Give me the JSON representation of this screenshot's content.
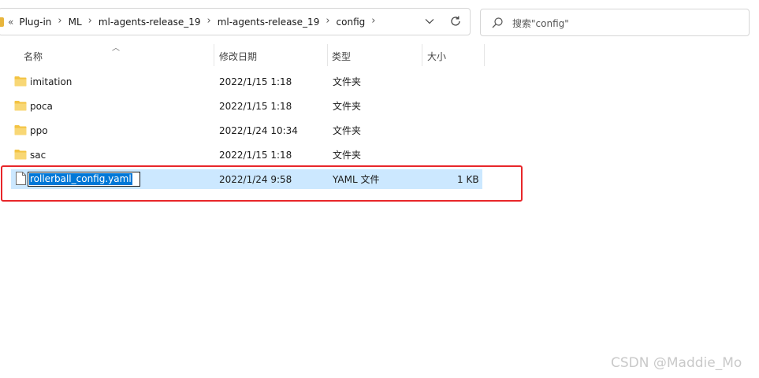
{
  "address_bar": {
    "overflow": "«",
    "crumbs": [
      "Plug-in",
      "ML",
      "ml-agents-release_19",
      "ml-agents-release_19",
      "config"
    ],
    "separator": "›"
  },
  "search": {
    "placeholder": "搜索\"config\""
  },
  "columns": {
    "name": "名称",
    "modified": "修改日期",
    "type": "类型",
    "size": "大小"
  },
  "files": [
    {
      "name": "imitation",
      "modified": "2022/1/15 1:18",
      "type": "文件夹",
      "size": "",
      "icon": "folder-icon"
    },
    {
      "name": "poca",
      "modified": "2022/1/15 1:18",
      "type": "文件夹",
      "size": "",
      "icon": "folder-icon"
    },
    {
      "name": "ppo",
      "modified": "2022/1/24 10:34",
      "type": "文件夹",
      "size": "",
      "icon": "folder-icon"
    },
    {
      "name": "sac",
      "modified": "2022/1/15 1:18",
      "type": "文件夹",
      "size": "",
      "icon": "folder-icon"
    },
    {
      "name": "rollerball_config.yaml",
      "modified": "2022/1/24 9:58",
      "type": "YAML 文件",
      "size": "1 KB",
      "icon": "file-icon",
      "selected": true,
      "renaming": true
    }
  ],
  "colors": {
    "selection": "#cce8ff",
    "rename_highlight": "#0078d7",
    "annotation_box": "#e8262a",
    "folder": "#f3c342"
  },
  "watermark": "CSDN @Maddie_Mo"
}
